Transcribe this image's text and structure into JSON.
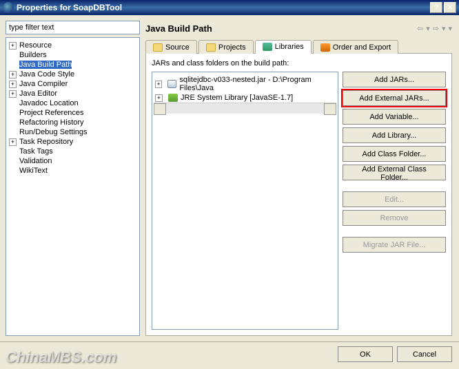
{
  "window": {
    "title": "Properties for SoapDBTool"
  },
  "filter": {
    "value": "type filter text"
  },
  "tree": [
    {
      "label": "Resource",
      "expandable": true,
      "level": 0
    },
    {
      "label": "Builders",
      "expandable": false,
      "level": 0
    },
    {
      "label": "Java Build Path",
      "expandable": false,
      "level": 0,
      "selected": true
    },
    {
      "label": "Java Code Style",
      "expandable": true,
      "level": 0
    },
    {
      "label": "Java Compiler",
      "expandable": true,
      "level": 0
    },
    {
      "label": "Java Editor",
      "expandable": true,
      "level": 0
    },
    {
      "label": "Javadoc Location",
      "expandable": false,
      "level": 0
    },
    {
      "label": "Project References",
      "expandable": false,
      "level": 0
    },
    {
      "label": "Refactoring History",
      "expandable": false,
      "level": 0
    },
    {
      "label": "Run/Debug Settings",
      "expandable": false,
      "level": 0
    },
    {
      "label": "Task Repository",
      "expandable": true,
      "level": 0
    },
    {
      "label": "Task Tags",
      "expandable": false,
      "level": 0
    },
    {
      "label": "Validation",
      "expandable": false,
      "level": 0
    },
    {
      "label": "WikiText",
      "expandable": false,
      "level": 0
    }
  ],
  "page": {
    "title": "Java Build Path"
  },
  "tabs": [
    {
      "label": "Source",
      "icon": "ti-src"
    },
    {
      "label": "Projects",
      "icon": "ti-prj"
    },
    {
      "label": "Libraries",
      "icon": "ti-lib",
      "active": true
    },
    {
      "label": "Order and Export",
      "icon": "ti-ord"
    }
  ],
  "libs": {
    "desc": "JARs and class folders on the build path:",
    "items": [
      {
        "label": "sqlitejdbc-v033-nested.jar - D:\\Program Files\\Java",
        "icon": "jar-icon"
      },
      {
        "label": "JRE System Library [JavaSE-1.7]",
        "icon": "jre-icon"
      }
    ]
  },
  "buttons": {
    "addJars": "Add JARs...",
    "addExternalJars": "Add External JARs...",
    "addVariable": "Add Variable...",
    "addLibrary": "Add Library...",
    "addClassFolder": "Add Class Folder...",
    "addExternalClassFolder": "Add External Class Folder...",
    "edit": "Edit...",
    "remove": "Remove",
    "migrate": "Migrate JAR File..."
  },
  "bottom": {
    "ok": "OK",
    "cancel": "Cancel"
  },
  "watermark": "ChinaMBS.com"
}
